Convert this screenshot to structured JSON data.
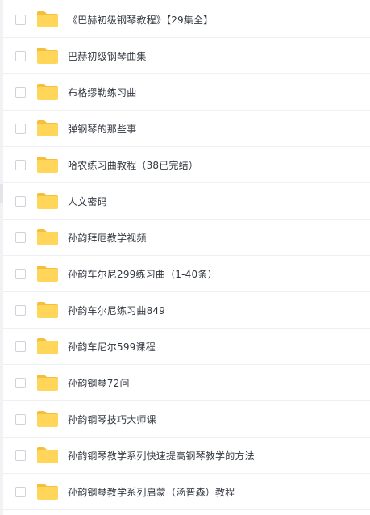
{
  "file_list": {
    "items": [
      {
        "name": "《巴赫初级钢琴教程》【29集全】",
        "icon": "folder-icon"
      },
      {
        "name": "巴赫初级钢琴曲集",
        "icon": "folder-icon"
      },
      {
        "name": "布格缪勒练习曲",
        "icon": "folder-icon"
      },
      {
        "name": "弹钢琴的那些事",
        "icon": "folder-icon"
      },
      {
        "name": "哈农练习曲教程（38已完结）",
        "icon": "folder-icon"
      },
      {
        "name": "人文密码",
        "icon": "folder-icon"
      },
      {
        "name": "孙韵拜厄教学视频",
        "icon": "folder-icon"
      },
      {
        "name": "孙韵车尔尼299练习曲（1-40条）",
        "icon": "folder-icon"
      },
      {
        "name": "孙韵车尔尼练习曲849",
        "icon": "folder-icon"
      },
      {
        "name": "孙韵车尼尔599课程",
        "icon": "folder-icon"
      },
      {
        "name": "孙韵钢琴72问",
        "icon": "folder-icon"
      },
      {
        "name": "孙韵钢琴技巧大师课",
        "icon": "folder-icon"
      },
      {
        "name": "孙韵钢琴教学系列快速提高钢琴教学的方法",
        "icon": "folder-icon"
      },
      {
        "name": "孙韵钢琴教学系列启蒙（汤普森）教程",
        "icon": "folder-icon"
      }
    ]
  },
  "colors": {
    "folder_main": "#ffd659",
    "folder_tab": "#f5bf3c",
    "text": "#333840",
    "divider": "#eef0f3",
    "checkbox_border": "#cfd3d9"
  }
}
